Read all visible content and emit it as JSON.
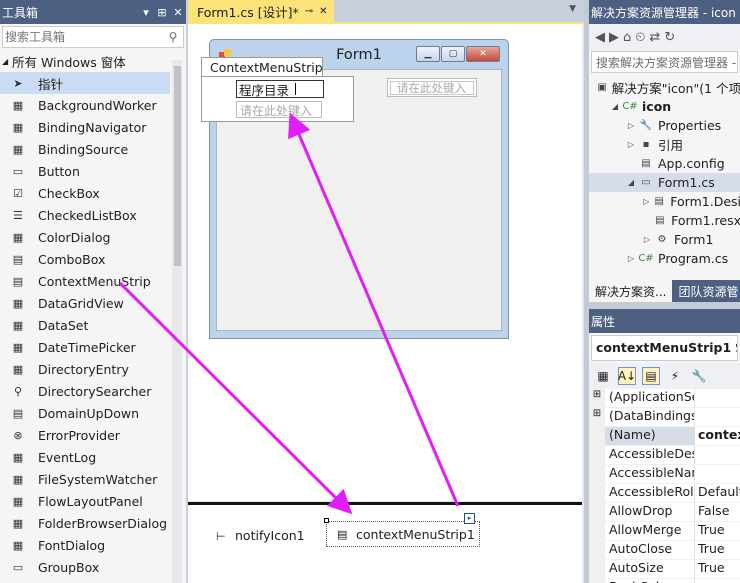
{
  "toolbox": {
    "title": "工具箱",
    "title_buttons": [
      "▾",
      "⊞",
      "✕"
    ],
    "search_placeholder": "搜索工具箱",
    "group": "所有 Windows 窗体",
    "items": [
      {
        "icon": "pointer-icon",
        "glyph": "➤",
        "label": "指针"
      },
      {
        "icon": "backgroundworker-icon",
        "glyph": "▦",
        "label": "BackgroundWorker"
      },
      {
        "icon": "bindingnavigator-icon",
        "glyph": "▦",
        "label": "BindingNavigator"
      },
      {
        "icon": "bindingsource-icon",
        "glyph": "▦",
        "label": "BindingSource"
      },
      {
        "icon": "button-icon",
        "glyph": "▭",
        "label": "Button"
      },
      {
        "icon": "checkbox-icon",
        "glyph": "☑",
        "label": "CheckBox"
      },
      {
        "icon": "checkedlistbox-icon",
        "glyph": "☰",
        "label": "CheckedListBox"
      },
      {
        "icon": "colordialog-icon",
        "glyph": "▦",
        "label": "ColorDialog"
      },
      {
        "icon": "combobox-icon",
        "glyph": "▤",
        "label": "ComboBox"
      },
      {
        "icon": "contextmenustrip-icon",
        "glyph": "▤",
        "label": "ContextMenuStrip"
      },
      {
        "icon": "datagridview-icon",
        "glyph": "▦",
        "label": "DataGridView"
      },
      {
        "icon": "dataset-icon",
        "glyph": "▦",
        "label": "DataSet"
      },
      {
        "icon": "datetimepicker-icon",
        "glyph": "▦",
        "label": "DateTimePicker"
      },
      {
        "icon": "directoryentry-icon",
        "glyph": "▦",
        "label": "DirectoryEntry"
      },
      {
        "icon": "directorysearcher-icon",
        "glyph": "⚲",
        "label": "DirectorySearcher"
      },
      {
        "icon": "domainupdown-icon",
        "glyph": "▤",
        "label": "DomainUpDown"
      },
      {
        "icon": "errorprovider-icon",
        "glyph": "⊗",
        "label": "ErrorProvider"
      },
      {
        "icon": "eventlog-icon",
        "glyph": "▦",
        "label": "EventLog"
      },
      {
        "icon": "filesystemwatcher-icon",
        "glyph": "▦",
        "label": "FileSystemWatcher"
      },
      {
        "icon": "flowlayoutpanel-icon",
        "glyph": "▦",
        "label": "FlowLayoutPanel"
      },
      {
        "icon": "folderbrowserdialog-icon",
        "glyph": "▦",
        "label": "FolderBrowserDialog"
      },
      {
        "icon": "fontdialog-icon",
        "glyph": "▦",
        "label": "FontDialog"
      },
      {
        "icon": "groupbox-icon",
        "glyph": "▭",
        "label": "GroupBox"
      }
    ]
  },
  "designer": {
    "tab_label": "Form1.cs [设计]*",
    "tab_pin": "⊸",
    "tab_close": "✕",
    "form_title": "Form1",
    "cms_header": "ContextMenuStrip",
    "menu_item_1": "程序目录",
    "menu_placeholder": "请在此处键入",
    "side_placeholder": "请在此处键入",
    "tray": {
      "notify": "notifyIcon1",
      "cms": "contextMenuStrip1"
    }
  },
  "solution": {
    "title": "解决方案资源管理器 - icon",
    "search": "搜索解决方案资源管理器 -",
    "nodes": [
      {
        "indent": 0,
        "exp": "",
        "icon": "solution-icon",
        "glyph": "▣",
        "label": "解决方案\"icon\"(1 个项"
      },
      {
        "indent": 1,
        "exp": "◢",
        "icon": "csharp-project-icon",
        "glyph": "C#",
        "label": "icon",
        "bold": true
      },
      {
        "indent": 2,
        "exp": "▷",
        "icon": "wrench-icon",
        "glyph": "🔧",
        "label": "Properties"
      },
      {
        "indent": 2,
        "exp": "▷",
        "icon": "references-icon",
        "glyph": "▪",
        "label": "引用"
      },
      {
        "indent": 2,
        "exp": "",
        "icon": "config-icon",
        "glyph": "▤",
        "label": "App.config"
      },
      {
        "indent": 2,
        "exp": "◢",
        "icon": "form-file-icon",
        "glyph": "▭",
        "label": "Form1.cs",
        "sel": true
      },
      {
        "indent": 3,
        "exp": "▷",
        "icon": "designer-file-icon",
        "glyph": "▤",
        "label": "Form1.Desi"
      },
      {
        "indent": 3,
        "exp": "",
        "icon": "resx-file-icon",
        "glyph": "▤",
        "label": "Form1.resx"
      },
      {
        "indent": 3,
        "exp": "▷",
        "icon": "class-icon",
        "glyph": "⚙",
        "label": "Form1"
      },
      {
        "indent": 2,
        "exp": "▷",
        "icon": "csharp-file-icon",
        "glyph": "C#",
        "label": "Program.cs"
      }
    ],
    "tabs": [
      "解决方案资...",
      "团队资源管"
    ]
  },
  "properties": {
    "title": "属性",
    "object_name": "contextMenuStrip1",
    "object_type": "Syst",
    "rows": [
      {
        "exp": "⊞",
        "name": "(ApplicationSet",
        "value": ""
      },
      {
        "exp": "⊞",
        "name": "(DataBindings)",
        "value": ""
      },
      {
        "exp": "",
        "name": "(Name)",
        "value": "context",
        "bold": true,
        "sel": true
      },
      {
        "exp": "",
        "name": "AccessibleDesc",
        "value": ""
      },
      {
        "exp": "",
        "name": "AccessibleNam",
        "value": ""
      },
      {
        "exp": "",
        "name": "AccessibleRole",
        "value": "Default"
      },
      {
        "exp": "",
        "name": "AllowDrop",
        "value": "False"
      },
      {
        "exp": "",
        "name": "AllowMerge",
        "value": "True"
      },
      {
        "exp": "",
        "name": "AutoClose",
        "value": "True"
      },
      {
        "exp": "",
        "name": "AutoSize",
        "value": "True"
      },
      {
        "exp": "",
        "name": "BackColor",
        "value": ""
      }
    ]
  },
  "colors": {
    "accent_tab": "#fbe37a",
    "panel_title": "#4d6082",
    "annotation_arrow": "#e31df5"
  }
}
